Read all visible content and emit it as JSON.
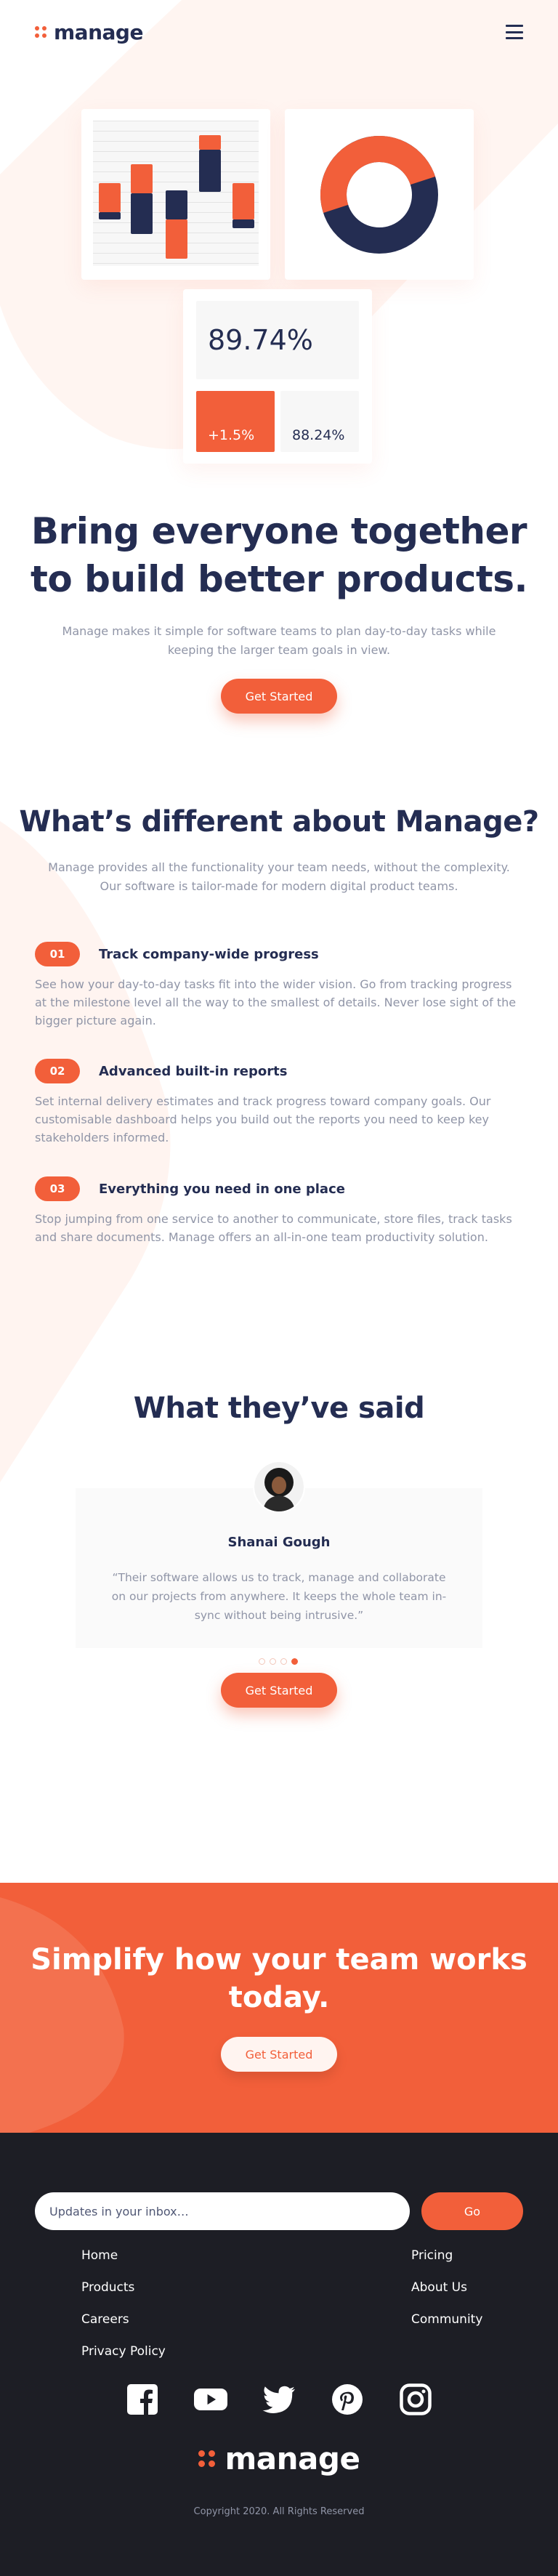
{
  "colors": {
    "accent": "#f25f3a",
    "navy": "#242d52",
    "muted": "#9095a7",
    "peach": "#fff4f0",
    "footer_bg": "#1d1e25"
  },
  "header": {
    "logo_text": "manage",
    "menu_icon": "hamburger-icon"
  },
  "hero": {
    "stats": {
      "big": "89.74%",
      "small_orange": "+1.5%",
      "small_grey": "88.24%"
    },
    "title": "Bring everyone together to build better products.",
    "subtitle": "Manage makes it simple for software teams to plan day-to-day tasks while keeping the larger team goals in view.",
    "cta": "Get Started"
  },
  "features": {
    "title": "What’s different about Manage?",
    "intro": "Manage provides all the functionality your team needs, without the complexity. Our software is tailor-made for modern digital product teams.",
    "items": [
      {
        "num": "01",
        "title": "Track company-wide progress",
        "text": "See how your day-to-day tasks fit into the wider vision. Go from tracking progress at the milestone level all the way to the smallest of details. Never lose sight of the bigger picture again."
      },
      {
        "num": "02",
        "title": "Advanced built-in reports",
        "text": "Set internal delivery estimates and track progress toward company goals. Our customisable dashboard helps you build out the reports you need to keep key stakeholders informed."
      },
      {
        "num": "03",
        "title": "Everything you need in one place",
        "text": "Stop jumping from one service to another to communicate, store files, track tasks and share documents. Manage offers an all-in-one team productivity solution."
      }
    ]
  },
  "testimonials": {
    "title": "What they’ve said",
    "name": "Shanai Gough",
    "quote": "“Their software allows us to track, manage and collaborate on our projects from anywhere. It keeps the whole team in-sync without being intrusive.”",
    "active_dot": 4,
    "dot_count": 4,
    "cta": "Get Started"
  },
  "cta_band": {
    "title": "Simplify how your team works today.",
    "button": "Get Started"
  },
  "footer": {
    "newsletter_placeholder": "Updates in your inbox…",
    "go_button": "Go",
    "links_left": [
      "Home",
      "Products",
      "Careers",
      "Privacy Policy"
    ],
    "links_right": [
      "Pricing",
      "About Us",
      "Community"
    ],
    "socials": [
      "facebook-icon",
      "youtube-icon",
      "twitter-icon",
      "pinterest-icon",
      "instagram-icon"
    ],
    "logo_text": "manage",
    "copyright": "Copyright 2020. All Rights Reserved"
  }
}
